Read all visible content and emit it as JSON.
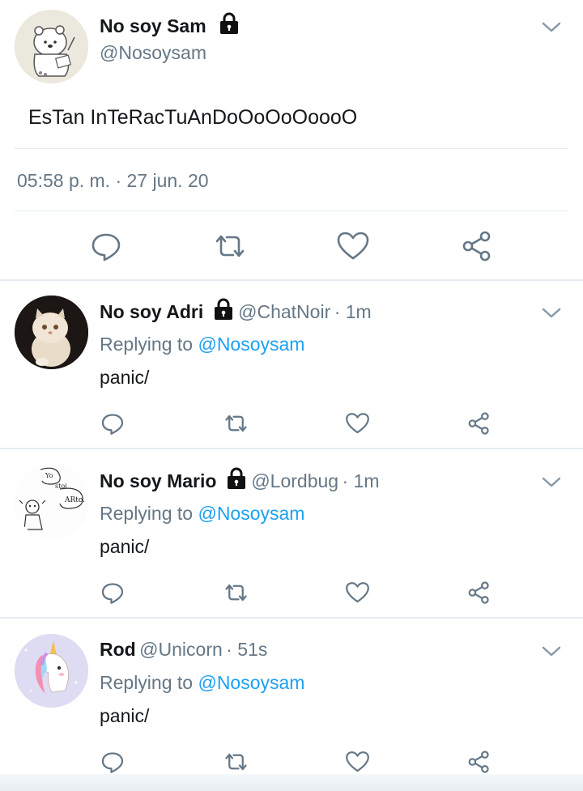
{
  "main_tweet": {
    "name": "No soy Sam",
    "handle": "@Nosoysam",
    "text": "EsTan InTeRacTuAnDoOoOoOoooO",
    "timestamp": "05:58 p. m. · 27 jun. 20",
    "avatar_icon": "bear-drawing-avatar"
  },
  "replies": [
    {
      "name": "No soy Adri",
      "handle": "@ChatNoir",
      "time": "· 1m",
      "locked": true,
      "replying_prefix": "Replying to ",
      "replying_to": "@Nosoysam",
      "text": "panic/",
      "avatar_icon": "persian-cat-avatar"
    },
    {
      "name": "No soy Mario",
      "handle": "@Lordbug",
      "time": "· 1m",
      "locked": true,
      "replying_prefix": "Replying to ",
      "replying_to": "@Nosoysam",
      "text": "panic/",
      "avatar_icon": "sketch-drawing-avatar",
      "avatar_text": [
        "Yo",
        "stoi",
        "ARto."
      ]
    },
    {
      "name": "Rod",
      "handle": "@Unicorn",
      "time": "· 51s",
      "locked": false,
      "replying_prefix": "Replying to ",
      "replying_to": "@Nosoysam",
      "text": "panic/",
      "avatar_icon": "unicorn-avatar"
    }
  ],
  "colors": {
    "accent": "#1da1f2",
    "secondary_text": "#657786",
    "icon": "#657786",
    "divider": "#e6ecf0"
  }
}
